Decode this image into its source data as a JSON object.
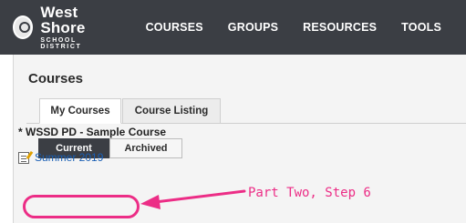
{
  "brand": {
    "title": "West Shore",
    "subtitle": "SCHOOL DISTRICT"
  },
  "nav": [
    {
      "label": "COURSES"
    },
    {
      "label": "GROUPS"
    },
    {
      "label": "RESOURCES"
    },
    {
      "label": "TOOLS"
    }
  ],
  "page": {
    "title": "Courses"
  },
  "tabs": [
    {
      "label": "My Courses",
      "active": true
    },
    {
      "label": "Course Listing",
      "active": false
    }
  ],
  "filters": [
    {
      "label": "Current",
      "active": true
    },
    {
      "label": "Archived",
      "active": false
    }
  ],
  "course": {
    "name": "* WSSD PD - Sample Course",
    "term_link": "Summer 2019"
  },
  "annotation": {
    "text": "Part Two, Step 6",
    "color": "#ec2d86"
  },
  "colors": {
    "nav_bg": "#3b3e44",
    "link": "#1a5fb4"
  }
}
